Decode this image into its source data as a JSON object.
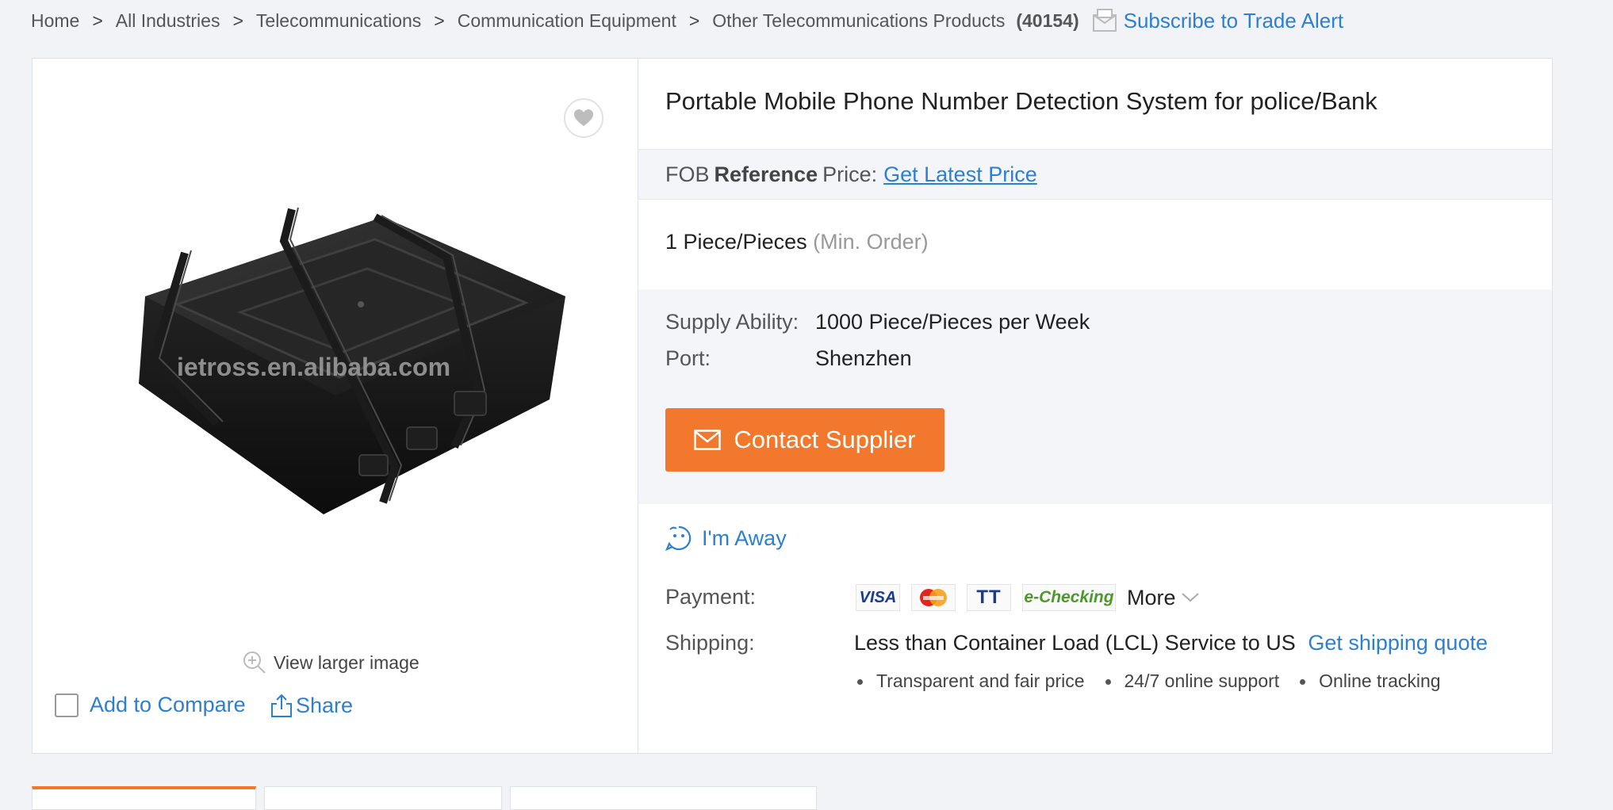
{
  "breadcrumb": {
    "items": [
      "Home",
      "All Industries",
      "Telecommunications",
      "Communication Equipment",
      "Other Telecommunications Products"
    ],
    "separator": ">",
    "count": "(40154)",
    "subscribe_label": "Subscribe to Trade Alert"
  },
  "gallery": {
    "watermark": "ietross.en.alibaba.com",
    "view_larger": "View larger image",
    "add_to_compare": "Add to Compare",
    "share": "Share"
  },
  "product": {
    "title": "Portable Mobile Phone Number Detection System for police/Bank",
    "price_prefix": "FOB",
    "price_bold": "Reference",
    "price_suffix": "Price:",
    "price_link": "Get Latest Price",
    "moq_value": "1 Piece/Pieces",
    "moq_note": "(Min. Order)",
    "supply_label": "Supply Ability:",
    "supply_value": "1000 Piece/Pieces per Week",
    "port_label": "Port:",
    "port_value": "Shenzhen",
    "contact_button": "Contact Supplier",
    "away_status": "I'm Away",
    "payment_label": "Payment:",
    "payment_methods": [
      "VISA",
      "MasterCard",
      "TT",
      "e-Checking"
    ],
    "payment_more": "More",
    "shipping_label": "Shipping:",
    "shipping_value": "Less than Container Load (LCL) Service to US",
    "shipping_link": "Get shipping quote",
    "shipping_features": [
      "Transparent and fair price",
      "24/7 online support",
      "Online tracking"
    ]
  },
  "colors": {
    "accent_orange": "#f1782d",
    "link_blue": "#2d7fd0",
    "background": "#f2f3f7"
  }
}
